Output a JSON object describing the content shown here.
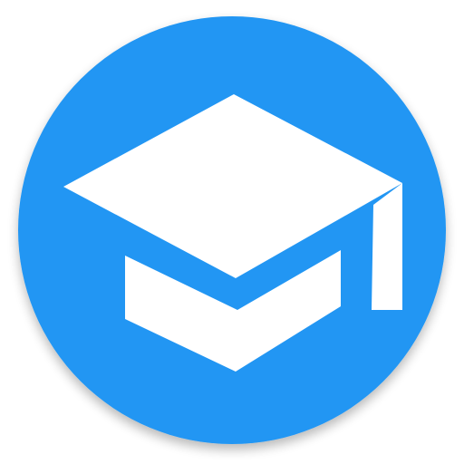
{
  "icon": {
    "name": "graduation-cap-icon",
    "colors": {
      "background_circle": "#2196F3",
      "glyph": "#FFFFFF",
      "shadow": "#000000"
    }
  }
}
